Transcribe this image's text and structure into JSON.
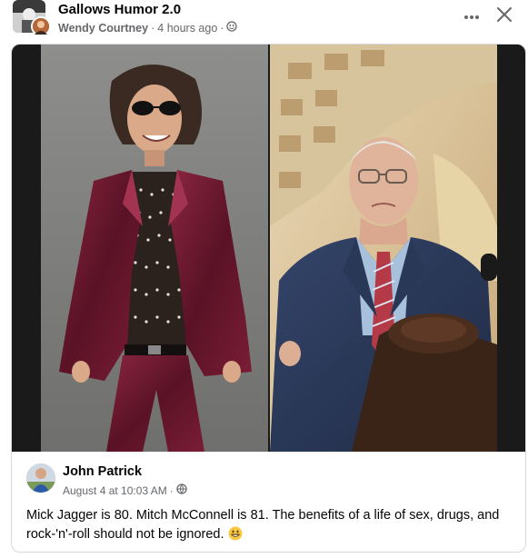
{
  "post": {
    "group_name": "Gallows Humor 2.0",
    "author": "Wendy Courtney",
    "separator": "·",
    "time": "4 hours ago",
    "separator2": "·",
    "privacy_icon": "group-globe-icon"
  },
  "toolbar": {
    "more_icon": "ellipsis-icon",
    "close_icon": "close-icon"
  },
  "shared_post": {
    "author": "John Patrick",
    "date": "August 4 at 10:03 AM",
    "separator": "·",
    "privacy_icon": "globe-icon",
    "text": "Mick Jagger is 80. Mitch McConnell is 81. The benefits of a life of sex, drugs, and rock-'n'-roll should not be ignored.",
    "emoji": "grinning-face-emoji"
  },
  "colors": {
    "text_primary": "#050505",
    "text_secondary": "#65676b",
    "border": "#d6d8dc",
    "suit_burgundy": "#6b1a2e",
    "suit_navy": "#27344f"
  }
}
